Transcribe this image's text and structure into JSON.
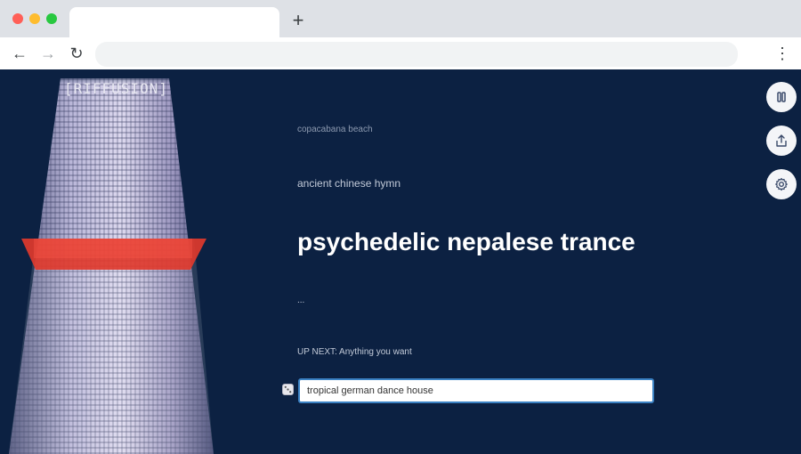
{
  "browser": {
    "new_tab_label": "+",
    "back_label": "←",
    "forward_label": "→",
    "reload_label": "↻",
    "menu_label": "⋮",
    "address": ""
  },
  "app": {
    "logo": "[RIFFUSION]"
  },
  "prompts": {
    "previous_2": "copacabana beach",
    "previous_1": "ancient chinese hymn",
    "current": "psychedelic nepalese trance",
    "next_placeholder": "..."
  },
  "up_next": {
    "label": "UP NEXT: Anything you want",
    "input_value": "tropical german dance house"
  },
  "icons": {
    "pause": "pause-icon",
    "share": "share-icon",
    "settings": "gear-icon",
    "dice": "dice-icon"
  },
  "colors": {
    "background": "#0c2142",
    "accent_red": "#e03a2c",
    "input_border": "#3b82c4"
  }
}
